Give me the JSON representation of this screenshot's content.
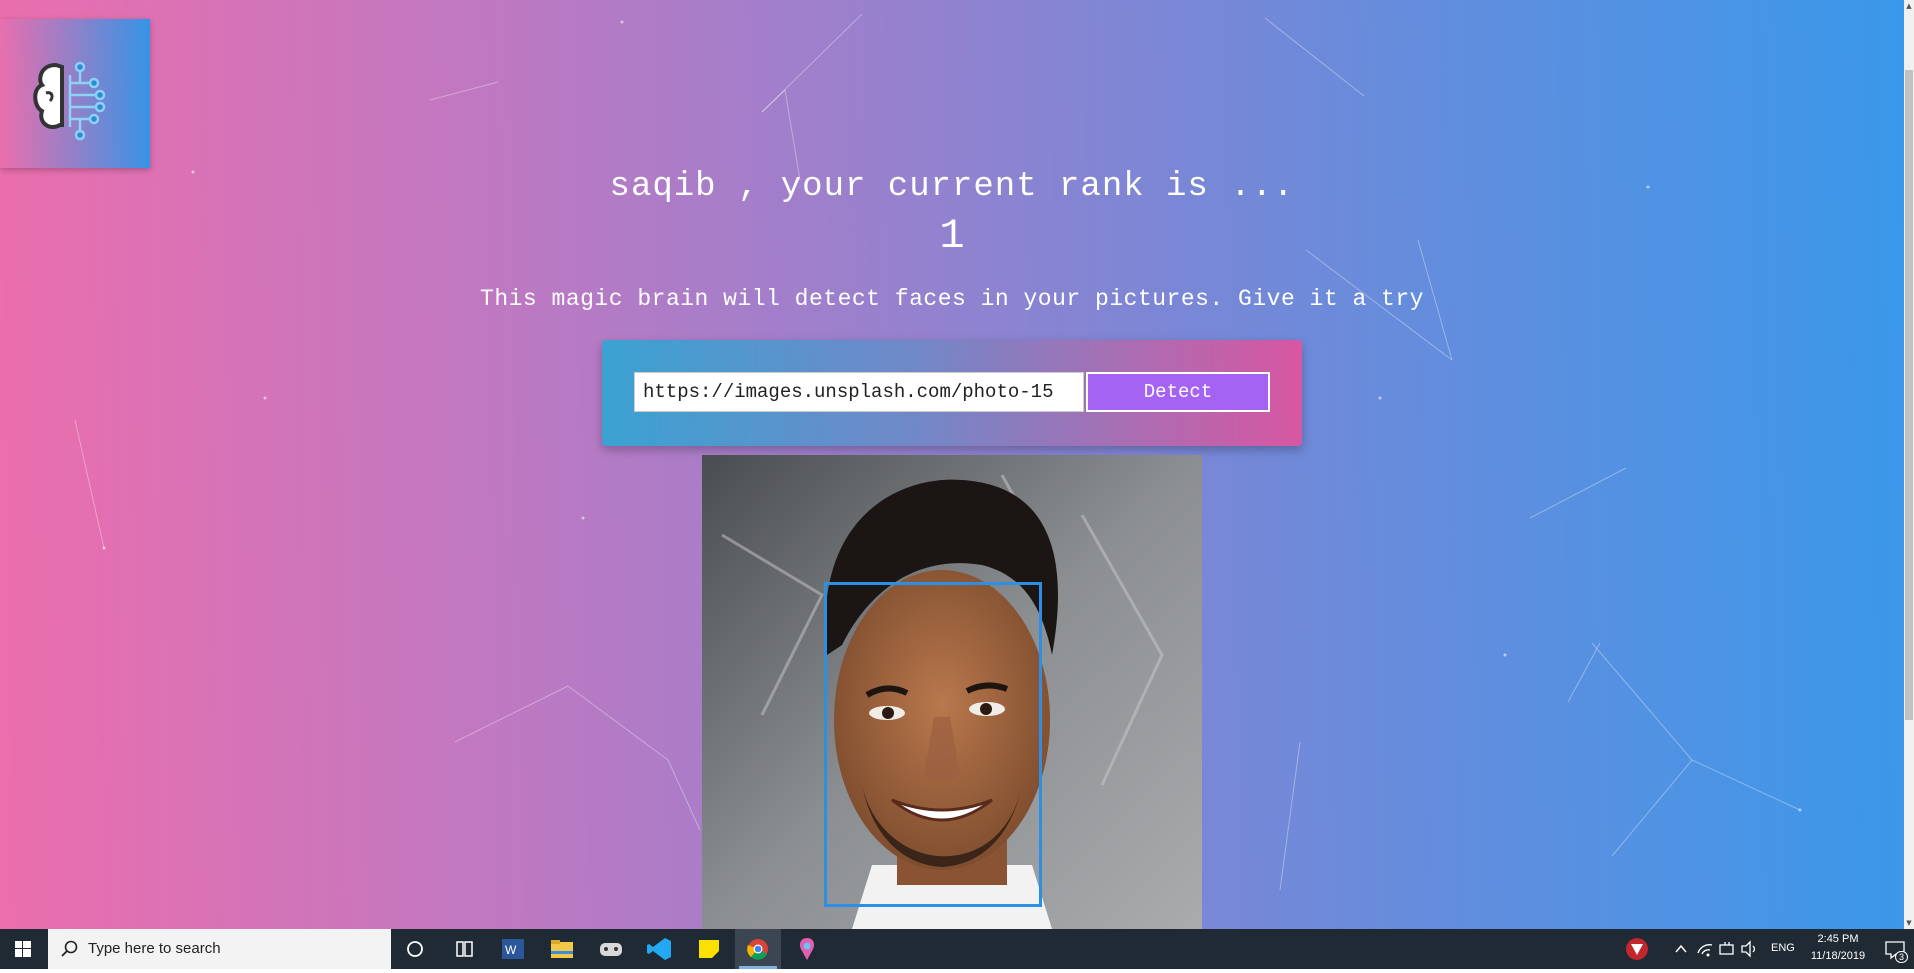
{
  "logo": {
    "icon": "brain-circuit-icon"
  },
  "rank": {
    "title": "saqib , your current rank is ...",
    "value": "1"
  },
  "tagline": "This magic brain will detect faces in your pictures. Give it a try",
  "form": {
    "url_value": "https://images.unsplash.com/photo-15",
    "detect_label": "Detect"
  },
  "photo": {
    "description_icon": "portrait-photo",
    "face_box_color": "#2d8fe3"
  },
  "colors": {
    "gradient_start": "#ec6ead",
    "gradient_end": "#3494e6",
    "detect_button": "#a463f2"
  },
  "taskbar": {
    "search_placeholder": "Type here to search",
    "apps": [
      "cortana-icon",
      "task-view-icon",
      "word-icon",
      "file-explorer-icon",
      "game-controller-icon",
      "vscode-icon",
      "sticky-notes-icon",
      "chrome-icon",
      "paint-3d-icon"
    ],
    "tray": {
      "language": "ENG",
      "time": "2:45 PM",
      "date": "11/18/2019",
      "notifications": "3"
    }
  }
}
